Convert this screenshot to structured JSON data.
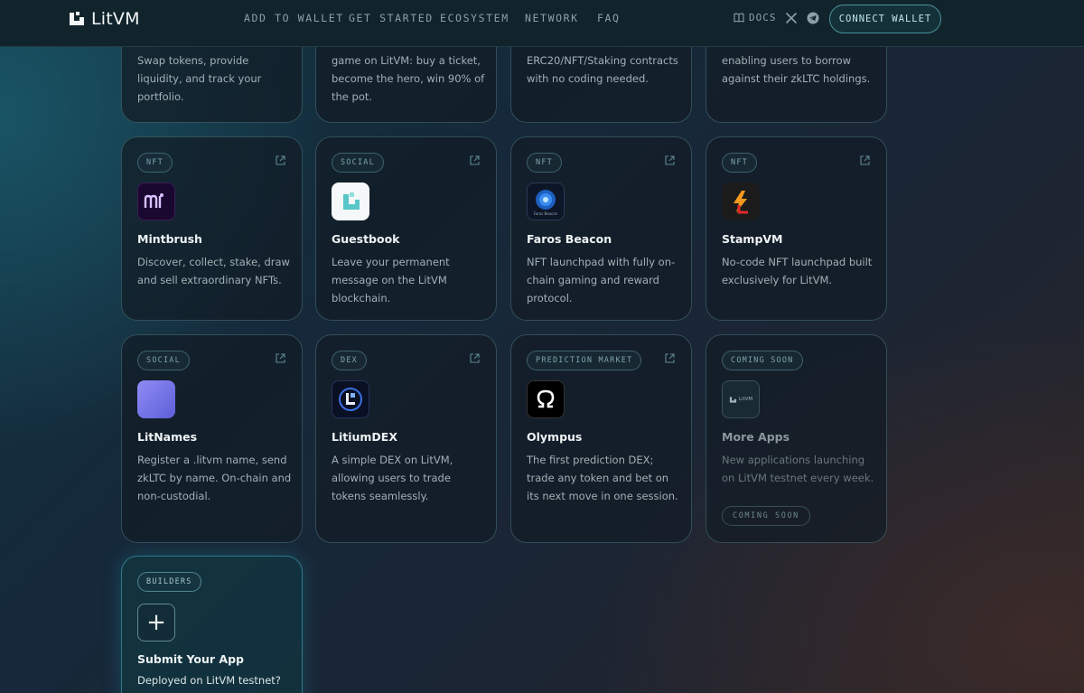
{
  "nav": {
    "brand": "LitVM",
    "links": [
      "ADD TO WALLET",
      "GET STARTED",
      "ECOSYSTEM",
      "NETWORK",
      "FAQ"
    ],
    "docs": "DOCS",
    "connect": "CONNECT WALLET"
  },
  "top_cards": [
    {
      "desc": "Swap tokens, provide liquidity, and track your portfolio."
    },
    {
      "desc": "game on LitVM: buy a ticket, become the hero, win 90% of the pot."
    },
    {
      "desc": "ERC20/NFT/Staking contracts with no coding needed."
    },
    {
      "desc": "enabling users to borrow against their zkLTC holdings."
    }
  ],
  "cards": [
    {
      "tag": "NFT",
      "title": "Mintbrush",
      "desc": "Discover, collect, stake, draw and sell extraordinary NFTs.",
      "icon": "mintbrush-logo"
    },
    {
      "tag": "SOCIAL",
      "title": "Guestbook",
      "desc": "Leave your permanent message on the LitVM blockchain.",
      "icon": "guestbook-logo"
    },
    {
      "tag": "NFT",
      "title": "Faros Beacon",
      "desc": "NFT launchpad with fully on-chain gaming and reward protocol.",
      "icon": "faros-beacon-logo"
    },
    {
      "tag": "NFT",
      "title": "StampVM",
      "desc": "No-code NFT launchpad built exclusively for LitVM.",
      "icon": "stampvm-logo"
    },
    {
      "tag": "SOCIAL",
      "title": "LitNames",
      "desc": "Register a .litvm name, send zkLTC by name. On-chain and non-custodial.",
      "icon": "litnames-logo"
    },
    {
      "tag": "DEX",
      "title": "LitiumDEX",
      "desc": "A simple DEX on LitVM, allowing users to trade tokens seamlessly.",
      "icon": "litiumdex-logo"
    },
    {
      "tag": "PREDICTION MARKET",
      "title": "Olympus",
      "desc": "The first prediction DEX; trade any token and bet on its next move in one session.",
      "icon": "olympus-logo"
    },
    {
      "tag": "COMING SOON",
      "title": "More Apps",
      "desc": "New applications launching on LitVM testnet every week.",
      "icon": "litvm-logo",
      "button": "COMING SOON"
    }
  ],
  "builders": {
    "tag": "BUILDERS",
    "title": "Submit Your App",
    "desc": "Deployed on LitVM testnet?",
    "plus": "+"
  },
  "icon_text": {
    "faros": "Faros Beacon",
    "litvm": "LitVM"
  }
}
